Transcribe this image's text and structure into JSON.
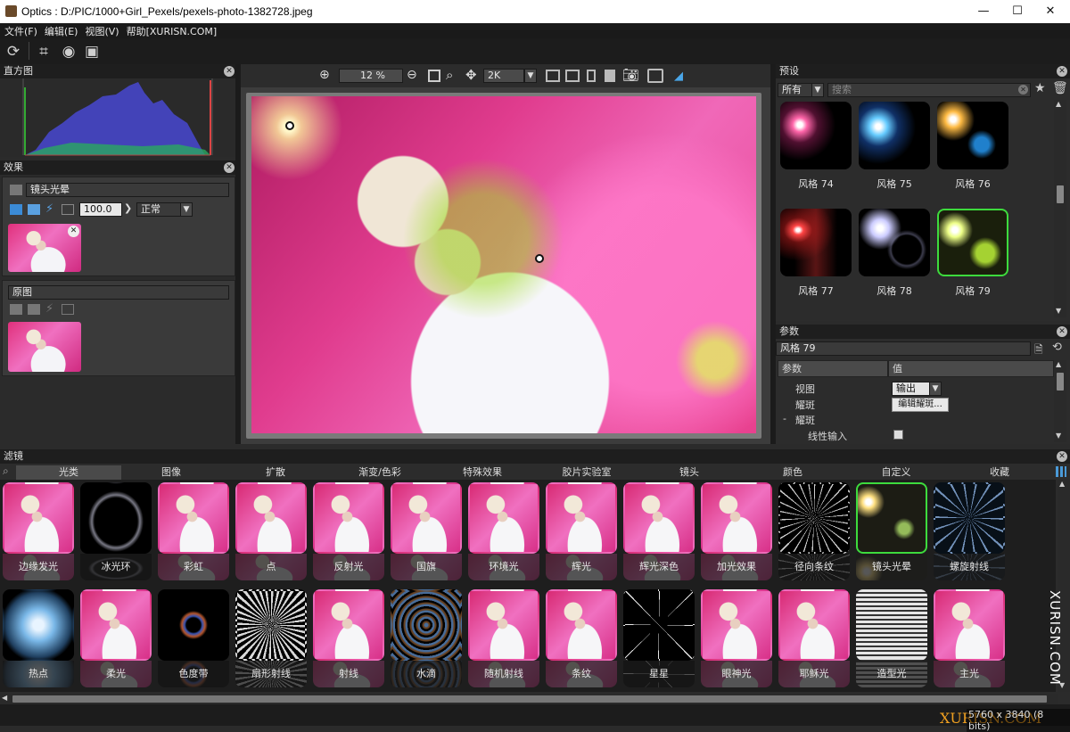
{
  "window": {
    "title": "Optics : D:/PIC/1000+Girl_Pexels/pexels-photo-1382728.jpeg",
    "minimize": "—",
    "maximize": "☐",
    "close": "✕"
  },
  "menu": [
    "文件(F)",
    "编辑(E)",
    "视图(V)",
    "帮助[XURISN.COM]"
  ],
  "histogram": {
    "title": "直方图"
  },
  "effects": {
    "title": "效果",
    "layer1_name": "镜头光晕",
    "layer1_opacity": "100.0",
    "layer1_blend": "正常",
    "layer2_name": "原图"
  },
  "viewer": {
    "zoom": "12 %",
    "resolution": "2K"
  },
  "presets": {
    "title": "预设",
    "filter": "所有",
    "search_placeholder": "搜索",
    "items": [
      {
        "label": "风格 74",
        "style": "pink-flare"
      },
      {
        "label": "风格 75",
        "style": "blue-star"
      },
      {
        "label": "风格 76",
        "style": "orange-blue"
      },
      {
        "label": "风格 77",
        "style": "red-streak"
      },
      {
        "label": "风格 78",
        "style": "white-ring"
      },
      {
        "label": "风格 79",
        "style": "green-hex",
        "selected": true
      }
    ]
  },
  "params": {
    "title": "参数",
    "preset_name": "风格 79",
    "col_param": "参数",
    "col_value": "值",
    "rows": [
      {
        "name": "视图",
        "value": "输出",
        "kind": "select"
      },
      {
        "name": "耀斑",
        "value": "编辑耀斑...",
        "kind": "button"
      },
      {
        "name": "耀斑",
        "value": "",
        "kind": "group",
        "prefix": "-"
      },
      {
        "name": "线性输入",
        "value": "",
        "kind": "checkbox"
      }
    ]
  },
  "filters": {
    "title": "滤镜",
    "tabs": [
      "光类",
      "图像",
      "扩散",
      "渐变/色彩",
      "特殊效果",
      "胶片实验室",
      "镜头",
      "颜色",
      "自定义",
      "收藏"
    ],
    "active_tab": "光类",
    "row1": [
      {
        "label": "边缘发光",
        "style": "photo"
      },
      {
        "label": "冰光环",
        "style": "ring"
      },
      {
        "label": "彩虹",
        "style": "photo"
      },
      {
        "label": "点",
        "style": "photo"
      },
      {
        "label": "反射光",
        "style": "photo"
      },
      {
        "label": "国旗",
        "style": "photo"
      },
      {
        "label": "环境光",
        "style": "photo"
      },
      {
        "label": "辉光",
        "style": "photo"
      },
      {
        "label": "辉光深色",
        "style": "photo"
      },
      {
        "label": "加光效果",
        "style": "photo"
      },
      {
        "label": "径向条纹",
        "style": "burst"
      },
      {
        "label": "镜头光晕",
        "style": "flare",
        "selected": true
      },
      {
        "label": "螺旋射线",
        "style": "spiral"
      }
    ],
    "row2": [
      {
        "label": "热点",
        "style": "hotspot"
      },
      {
        "label": "柔光",
        "style": "photo"
      },
      {
        "label": "色度带",
        "style": "chroma"
      },
      {
        "label": "扇形射线",
        "style": "fan"
      },
      {
        "label": "射线",
        "style": "photo"
      },
      {
        "label": "水滴",
        "style": "drop"
      },
      {
        "label": "随机射线",
        "style": "photo"
      },
      {
        "label": "条纹",
        "style": "photo"
      },
      {
        "label": "星星",
        "style": "star"
      },
      {
        "label": "眼神光",
        "style": "photo"
      },
      {
        "label": "耶稣光",
        "style": "photo"
      },
      {
        "label": "造型光",
        "style": "stripes"
      },
      {
        "label": "主光",
        "style": "photo"
      }
    ]
  },
  "status": {
    "image_info": "5760 x 3840 (8 bits)"
  },
  "watermark": {
    "side": "XURISN.COM",
    "bottom": "XURISN.COM"
  }
}
